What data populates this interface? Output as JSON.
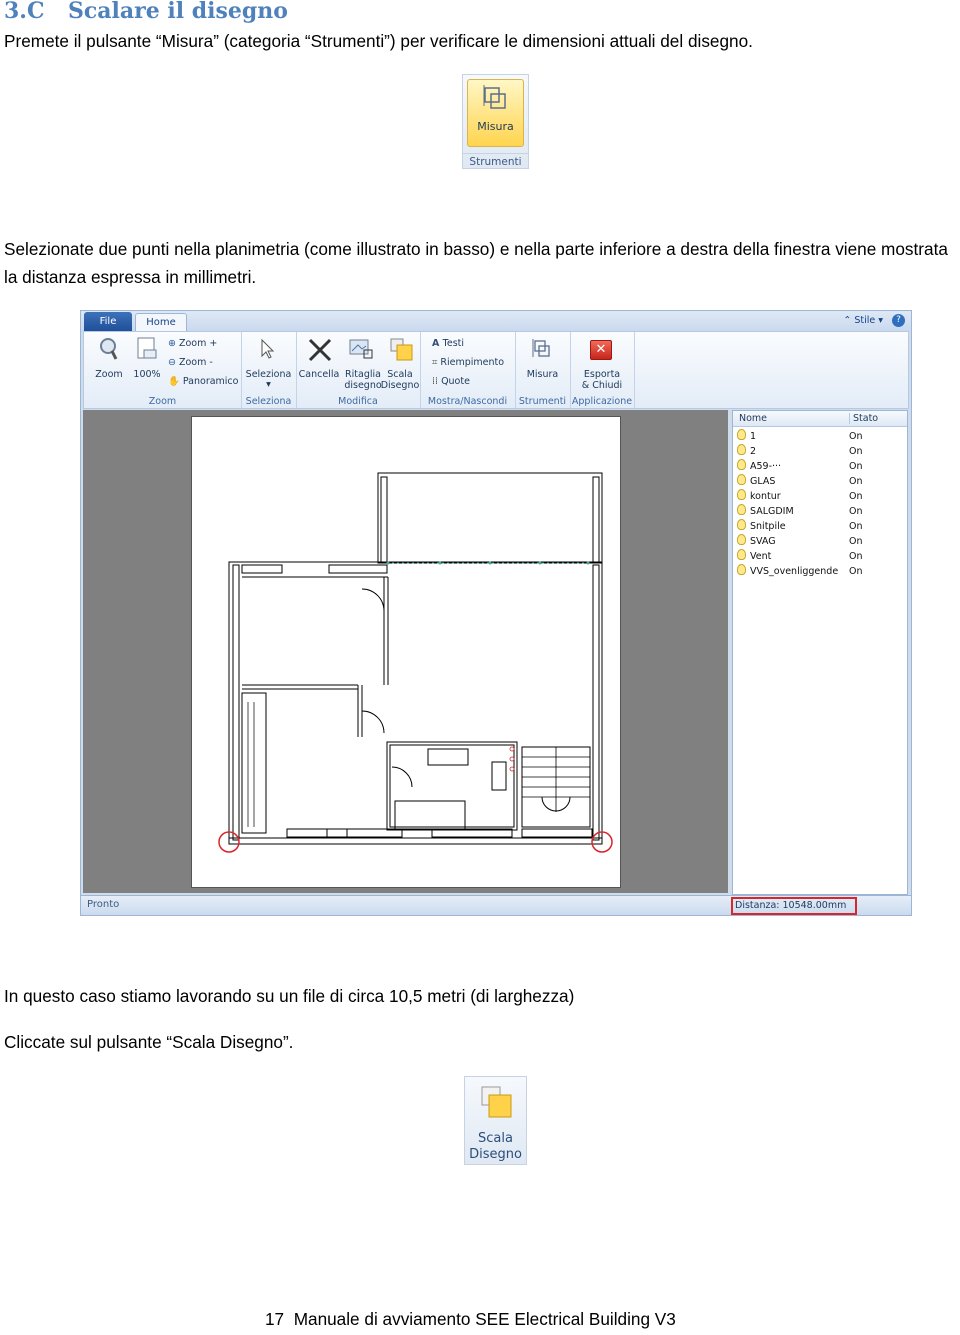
{
  "heading": {
    "number": "3.C",
    "title": "Scalare il disegno"
  },
  "intro": "Premete il pulsante “Misura” (categoria “Strumenti”) per verificare le dimensioni attuali del disegno.",
  "measure_button": {
    "label": "Misura",
    "category": "Strumenti"
  },
  "instruction": "Selezionate due punti nella planimetria (come illustrato in basso) e nella parte inferiore a destra della finestra viene mostrata la distanza espressa in millimetri.",
  "app": {
    "tabs": {
      "file": "File",
      "home": "Home"
    },
    "style_label": "Stile",
    "help_icon": "?",
    "ribbon": {
      "zoom": {
        "zoom_btn": "Zoom",
        "hundred": "100%",
        "zoom_in": "Zoom +",
        "zoom_out": "Zoom -",
        "pan": "Panoramico",
        "group": "Zoom"
      },
      "select": {
        "btn": "Seleziona",
        "group": "Seleziona"
      },
      "modify": {
        "delete": "Cancella",
        "crop1": "Ritaglia",
        "crop2": "disegno",
        "scale1": "Scala",
        "scale2": "Disegno",
        "group": "Modifica"
      },
      "show": {
        "texts": "Testi",
        "fill": "Riempimento",
        "dims": "Quote",
        "group": "Mostra/Nascondi"
      },
      "tools": {
        "measure": "Misura",
        "group": "Strumenti"
      },
      "app": {
        "export1": "Esporta",
        "export2": "& Chiudi",
        "group": "Applicazione"
      }
    },
    "layers": {
      "col_name": "Nome",
      "col_state": "Stato",
      "rows": [
        {
          "name": "1",
          "state": "On"
        },
        {
          "name": "2",
          "state": "On"
        },
        {
          "name": "A59-···",
          "state": "On"
        },
        {
          "name": "GLAS",
          "state": "On"
        },
        {
          "name": "kontur",
          "state": "On"
        },
        {
          "name": "SALGDIM",
          "state": "On"
        },
        {
          "name": "Snitpile",
          "state": "On"
        },
        {
          "name": "SVAG",
          "state": "On"
        },
        {
          "name": "Vent",
          "state": "On"
        },
        {
          "name": "VVS_ovenliggende",
          "state": "On"
        }
      ]
    },
    "status": {
      "ready": "Pronto",
      "distance": "Distanza: 10548.00mm"
    }
  },
  "case_note": "In questo caso stiamo lavorando su un file di circa 10,5 metri (di larghezza)",
  "click_scale": "Cliccate sul pulsante “Scala Disegno”.",
  "scale_button": {
    "line1": "Scala",
    "line2": "Disegno"
  },
  "footer": {
    "page": "17",
    "title": "Manuale di avviamento SEE Electrical Building V3"
  },
  "colors": {
    "heading": "#4f81bd",
    "highlight": "#d8262a"
  }
}
